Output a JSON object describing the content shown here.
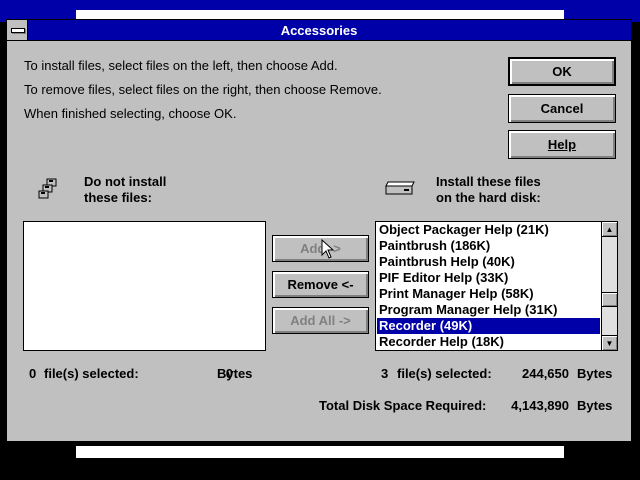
{
  "dialog": {
    "title": "Accessories",
    "instructions": [
      "To install files, select files on the left, then choose Add.",
      "To remove files, select files on the right, then choose Remove.",
      "When finished selecting, choose OK."
    ],
    "buttons": {
      "ok": "OK",
      "cancel": "Cancel",
      "help": "Help",
      "add": "Add ->",
      "remove": "Remove <-",
      "add_all": "Add All ->"
    },
    "left_panel": {
      "label_line1": "Do not install",
      "label_line2": "these files:",
      "items": [],
      "status": {
        "count": "0",
        "count_label": "file(s) selected:",
        "bytes": "0",
        "bytes_label": "Bytes"
      }
    },
    "right_panel": {
      "label_line1": "Install these files",
      "label_line2": "on the hard disk:",
      "items": [
        "Object Packager Help (21K)",
        "Paintbrush (186K)",
        "Paintbrush Help (40K)",
        "PIF Editor Help (33K)",
        "Print Manager Help (58K)",
        "Program Manager Help (31K)",
        "Recorder (49K)",
        "Recorder Help (18K)"
      ],
      "selected_item": "Recorder (49K)",
      "status": {
        "count": "3",
        "count_label": "file(s) selected:",
        "bytes": "244,650",
        "bytes_label": "Bytes"
      }
    },
    "total": {
      "label": "Total Disk Space Required:",
      "value": "4,143,890",
      "unit": "Bytes"
    }
  },
  "colors": {
    "titlebar": "#0000a8",
    "dialog_face": "#c0c0c0",
    "selection": "#0000a8"
  }
}
